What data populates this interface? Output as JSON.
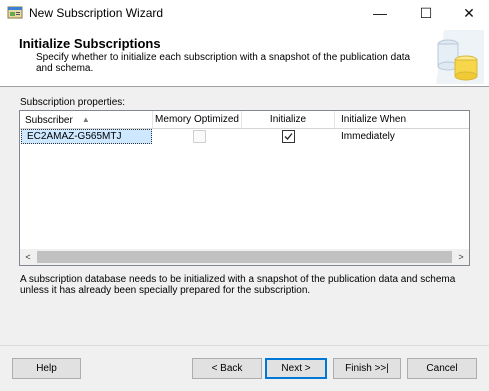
{
  "window": {
    "title": "New Subscription Wizard",
    "controls": {
      "minimize": "—",
      "maximize": "☐",
      "close": "✕"
    }
  },
  "header": {
    "title": "Initialize Subscriptions",
    "description": "Specify whether to initialize each subscription with a snapshot of the publication data and schema."
  },
  "grid": {
    "label": "Subscription properties:",
    "columns": [
      "Subscriber",
      "Memory Optimized",
      "Initialize",
      "Initialize When"
    ],
    "sort_indicator": "▲",
    "rows": [
      {
        "subscriber": "EC2AMAZ-G565MTJ",
        "memory_optimized": false,
        "initialize": true,
        "initialize_when": "Immediately"
      }
    ],
    "scroll_left": "<",
    "scroll_right": ">"
  },
  "note": "A subscription database needs to be initialized with a snapshot of the publication data and schema unless it has already been specially prepared for the subscription.",
  "buttons": {
    "help": "Help",
    "back": "< Back",
    "next": "Next >",
    "finish": "Finish >>|",
    "cancel": "Cancel"
  }
}
